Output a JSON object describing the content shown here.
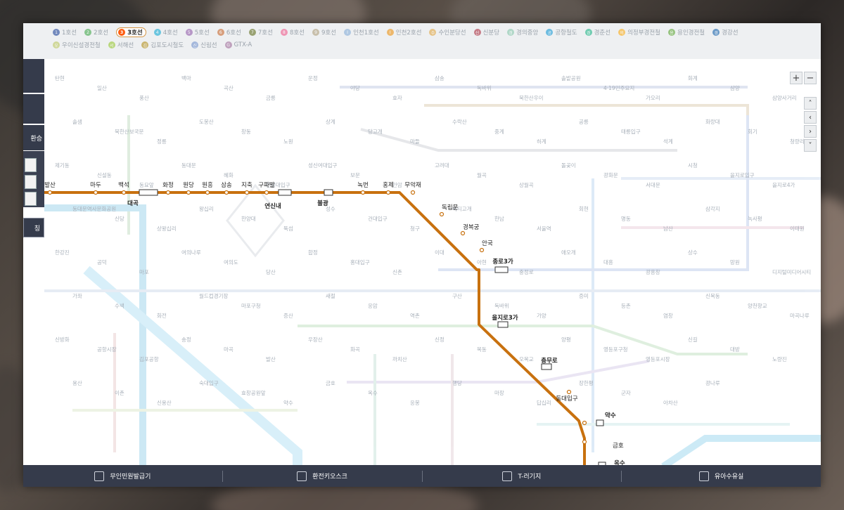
{
  "legend": {
    "lines": [
      {
        "num": "1",
        "label": "1호선",
        "color": "#0d3692",
        "active": false
      },
      {
        "num": "2",
        "label": "2호선",
        "color": "#33a23d",
        "active": false
      },
      {
        "num": "3",
        "label": "3호선",
        "color": "#fe5d10",
        "active": true
      },
      {
        "num": "4",
        "label": "4호선",
        "color": "#00a2d1",
        "active": false
      },
      {
        "num": "5",
        "label": "5호선",
        "color": "#8b50a4",
        "active": false
      },
      {
        "num": "6",
        "label": "6호선",
        "color": "#c55c1d",
        "active": false
      },
      {
        "num": "7",
        "label": "7호선",
        "color": "#54640d",
        "active": false
      },
      {
        "num": "8",
        "label": "8호선",
        "color": "#f14c82",
        "active": false
      },
      {
        "num": "9",
        "label": "9호선",
        "color": "#aa9872",
        "active": false
      },
      {
        "num": "I",
        "label": "인천1호선",
        "color": "#7ca8d5",
        "active": false
      },
      {
        "num": "I",
        "label": "인천2호선",
        "color": "#ed8b00",
        "active": false
      },
      {
        "num": "수",
        "label": "수인분당선",
        "color": "#e0a134",
        "active": false
      },
      {
        "num": "신",
        "label": "신분당",
        "color": "#a71e31",
        "active": false
      },
      {
        "num": "경",
        "label": "경의중앙",
        "color": "#7cc4a5",
        "active": false
      },
      {
        "num": "공",
        "label": "공항철도",
        "color": "#0090d2",
        "active": false
      },
      {
        "num": "경",
        "label": "경춘선",
        "color": "#08af7b",
        "active": false
      },
      {
        "num": "의",
        "label": "의정부경전철",
        "color": "#fda600",
        "active": false
      },
      {
        "num": "용",
        "label": "용인경전철",
        "color": "#509f22",
        "active": false
      },
      {
        "num": "경",
        "label": "경강선",
        "color": "#0054a6",
        "active": false
      },
      {
        "num": "우",
        "label": "우이신설경전철",
        "color": "#b7c452",
        "active": false
      },
      {
        "num": "서",
        "label": "서해선",
        "color": "#8fc31f",
        "active": false
      },
      {
        "num": "김",
        "label": "김포도시철도",
        "color": "#ad8605",
        "active": false
      },
      {
        "num": "신",
        "label": "신림선",
        "color": "#6789ca",
        "active": false
      },
      {
        "num": "G",
        "label": "GTX-A",
        "color": "#9a6292",
        "active": false
      }
    ]
  },
  "side_panel": {
    "transfer_label": "환승",
    "bottom_label": "칭"
  },
  "zoom": {
    "plus": "+",
    "minus": "−"
  },
  "pan": {
    "up": "˄",
    "left": "‹",
    "right": "›",
    "down": "˅"
  },
  "line3": {
    "color": "#c8710f",
    "stations": [
      {
        "name": "지축",
        "label_id": "s1"
      },
      {
        "name": "대곡",
        "label_id": "s2"
      }
    ]
  },
  "map_labels": {
    "west": [
      "발산",
      "마두",
      "백석",
      "대곡",
      "화정",
      "원당",
      "원흥",
      "삼송",
      "지축",
      "구파발",
      "연신내",
      "불광",
      "녹번",
      "홍제",
      "무악재"
    ],
    "south": [
      "독립문",
      "경복궁",
      "안국",
      "종로3가",
      "을지로3가",
      "충무로",
      "동대입구",
      "약수",
      "금호",
      "옥수"
    ]
  },
  "faded_labels": [
    "탄현",
    "일산",
    "풍산",
    "백마",
    "곡산",
    "금릉",
    "운정",
    "야당",
    "효자",
    "삼송",
    "독바위",
    "북한산우이",
    "솔밭공원",
    "4·19민주묘지",
    "가오리",
    "화계",
    "삼양",
    "삼양사거리",
    "솔샘",
    "북한산보국문",
    "정릉",
    "도봉산",
    "창동",
    "노원",
    "상계",
    "당고개",
    "마들",
    "수락산",
    "중계",
    "하계",
    "공릉",
    "태릉입구",
    "석계",
    "화랑대",
    "회기",
    "청량리",
    "제기동",
    "신설동",
    "동묘앞",
    "동대문",
    "혜화",
    "한성대입구",
    "성신여대입구",
    "보문",
    "안암",
    "고려대",
    "월곡",
    "상월곡",
    "돌곶이",
    "광화문",
    "서대문",
    "시청",
    "을지로입구",
    "을지로4가",
    "동대문역사문화공원",
    "신당",
    "상왕십리",
    "왕십리",
    "한양대",
    "뚝섬",
    "성수",
    "건대입구",
    "청구",
    "버티고개",
    "한남",
    "서울역",
    "회현",
    "명동",
    "남산",
    "삼각지",
    "녹사평",
    "이태원",
    "한강진",
    "공덕",
    "마포",
    "여의나루",
    "여의도",
    "당산",
    "합정",
    "홍대입구",
    "신촌",
    "이대",
    "아현",
    "충정로",
    "애오개",
    "대흥",
    "광흥창",
    "상수",
    "망원",
    "디지털미디어시티",
    "가좌",
    "수색",
    "화전",
    "월드컵경기장",
    "마포구청",
    "증산",
    "새절",
    "응암",
    "역촌",
    "구산",
    "독바위",
    "가양",
    "증미",
    "등촌",
    "염창",
    "신목동",
    "양천향교",
    "마곡나루",
    "신방화",
    "공항시장",
    "김포공항",
    "송정",
    "마곡",
    "발산",
    "우장산",
    "화곡",
    "까치산",
    "신정",
    "목동",
    "오목교",
    "양평",
    "영등포구청",
    "영등포시장",
    "신길",
    "대방",
    "노량진",
    "용산",
    "이촌",
    "신용산",
    "숙대입구",
    "효창공원앞",
    "약수",
    "금호",
    "옥수",
    "응봉",
    "행당",
    "마장",
    "답십리",
    "장한평",
    "군자",
    "아차산",
    "광나루"
  ],
  "bottom_bar": {
    "items": [
      {
        "label": "무인민원발급기",
        "icon": "kiosk-icon"
      },
      {
        "label": "환전키오스크",
        "icon": "exchange-icon"
      },
      {
        "label": "T-러기지",
        "icon": "luggage-icon"
      },
      {
        "label": "유아수유실",
        "icon": "nursing-icon"
      }
    ]
  }
}
